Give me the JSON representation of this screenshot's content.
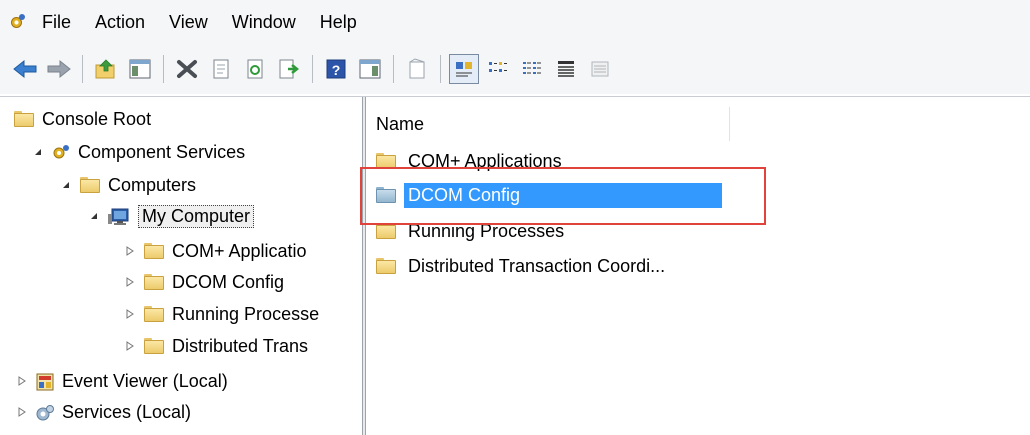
{
  "menu": {
    "items": [
      "File",
      "Action",
      "View",
      "Window",
      "Help"
    ]
  },
  "toolbar": {
    "buttons": [
      "back-arrow-icon",
      "forward-arrow-icon",
      "up-folder-icon",
      "show-hide-tree-icon",
      "delete-icon",
      "properties-icon",
      "refresh-icon",
      "export-list-icon",
      "help-icon",
      "show-hide-action-pane-icon",
      "new-window-icon",
      "large-icons-view-icon",
      "small-icons-view-icon",
      "list-view-icon",
      "detail-view-icon",
      "custom-view-icon"
    ]
  },
  "tree": {
    "console_root": "Console Root",
    "component_services": "Component Services",
    "computers": "Computers",
    "my_computer": "My Computer",
    "com_apps": "COM+ Applicatio",
    "dcom_config": "DCOM Config",
    "running_processes": "Running Processe",
    "distributed_trans": "Distributed Trans",
    "event_viewer": "Event Viewer (Local)",
    "services": "Services (Local)"
  },
  "list": {
    "column_name": "Name",
    "items": [
      {
        "label": "COM+ Applications",
        "selected": false
      },
      {
        "label": "DCOM Config",
        "selected": true
      },
      {
        "label": "Running Processes",
        "selected": false
      },
      {
        "label": "Distributed Transaction Coordi...",
        "selected": false
      }
    ]
  },
  "colors": {
    "selection": "#3399ff",
    "highlight_outline": "#e0433c"
  }
}
